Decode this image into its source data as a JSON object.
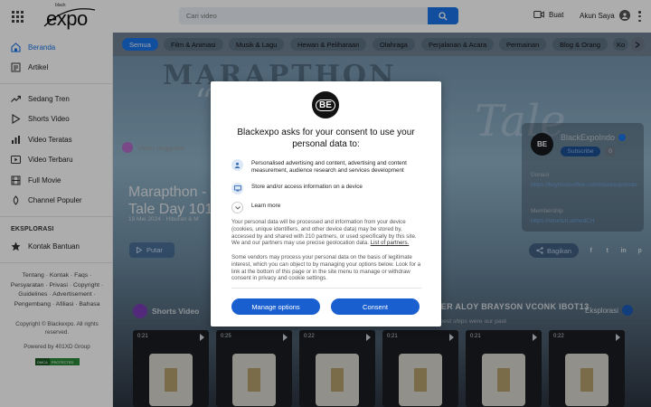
{
  "header": {
    "logo_small": "black",
    "logo_text": "expo",
    "search_placeholder": "Cari video",
    "create_label": "Buat",
    "account_label": "Akun Saya",
    "icons": [
      "grid-menu-icon",
      "search-icon",
      "video-camera-icon",
      "account-icon",
      "kebab-menu-icon"
    ]
  },
  "sidebar": {
    "items": [
      {
        "label": "Beranda",
        "icon": "home-icon",
        "active": true
      },
      {
        "label": "Artikel",
        "icon": "article-icon",
        "active": false
      },
      {
        "label": "Sedang Tren",
        "icon": "trending-icon",
        "active": false
      },
      {
        "label": "Shorts Video",
        "icon": "shorts-icon",
        "active": false
      },
      {
        "label": "Video Teratas",
        "icon": "chart-icon",
        "active": false
      },
      {
        "label": "Video Terbaru",
        "icon": "new-video-icon",
        "active": false
      },
      {
        "label": "Full Movie",
        "icon": "film-icon",
        "active": false
      },
      {
        "label": "Channel Populer",
        "icon": "popular-icon",
        "active": false
      }
    ],
    "explore_heading": "EKSPLORASI",
    "explore_items": [
      {
        "label": "Kontak Bantuan",
        "icon": "help-icon"
      }
    ],
    "footer_links": [
      "Tentang",
      "Kontak",
      "Faqs",
      "Persyaratan",
      "Privasi",
      "Copyright",
      "Guidelines",
      "Advertisement",
      "Pengembang",
      "Afiliasi",
      "Bahasa"
    ],
    "copyright": "Copyright © Blackexpo. All rights reserved.",
    "powered": "Powered by 401XD Group",
    "dmca_left": "DMCA",
    "dmca_right": "PROTECTED"
  },
  "chips": [
    "Semua",
    "Film & Animasi",
    "Musik & Lagu",
    "Hewan & Peliharaan",
    "Olahraga",
    "Perjalanan & Acara",
    "Permainan",
    "Blog & Orang",
    "Ko"
  ],
  "hero": {
    "big_text": "MARAPTHON",
    "quote": "“",
    "script_text": "Tale",
    "video_tag": "Video unggulan",
    "title_line1": "Marapthon - T",
    "title_line2": "Tale Day 101 l",
    "meta": "19 Mei 2024 · Hiburan & M",
    "play_label": "Putar"
  },
  "channel": {
    "logo": "BE",
    "name": "BlackExpoIndo",
    "subscribe": "Subscribe",
    "subs_count": "0",
    "donasi_label": "Donasi",
    "donasi_link": "https://buymeacoffee.com/blackexpoindo",
    "membership_label": "Membership",
    "membership_link": "https://shorturl.at/hodCH",
    "share_label": "Bagikan",
    "social": [
      "f",
      "t",
      "in",
      "p"
    ]
  },
  "shorts": {
    "heading": "Shorts Video",
    "explore": "Eksplorasi",
    "band_names": "TER ALOY   BRAYSON VCONK   IBOT13",
    "band_sub": "...e best ships were our past",
    "cards": [
      {
        "time": "0:21"
      },
      {
        "time": "0:25"
      },
      {
        "time": "0:22"
      },
      {
        "time": "0:21"
      },
      {
        "time": "0:21"
      },
      {
        "time": "0:22"
      }
    ]
  },
  "consent": {
    "logo": "BE",
    "title": "Blackexpo asks for your consent to use your personal data to:",
    "purposes": [
      {
        "icon": "person-icon",
        "text": "Personalised advertising and content, advertising and content measurement, audience research and services development"
      },
      {
        "icon": "device-icon",
        "text": "Store and/or access information on a device"
      }
    ],
    "learn_more": "Learn more",
    "body1": "Your personal data will be processed and information from your device (cookies, unique identifiers, and other device data) may be stored by, accessed by and shared with 210 partners, or used specifically by this site. We and our partners may use precise geolocation data.",
    "body1_link": "List of partners.",
    "body2": "Some vendors may process your personal data on the basis of legitimate interest, which you can object to by managing your options below. Look for a link at the bottom of this page or in the site menu to manage or withdraw consent in privacy and cookie settings.",
    "manage_label": "Manage options",
    "consent_label": "Consent"
  }
}
